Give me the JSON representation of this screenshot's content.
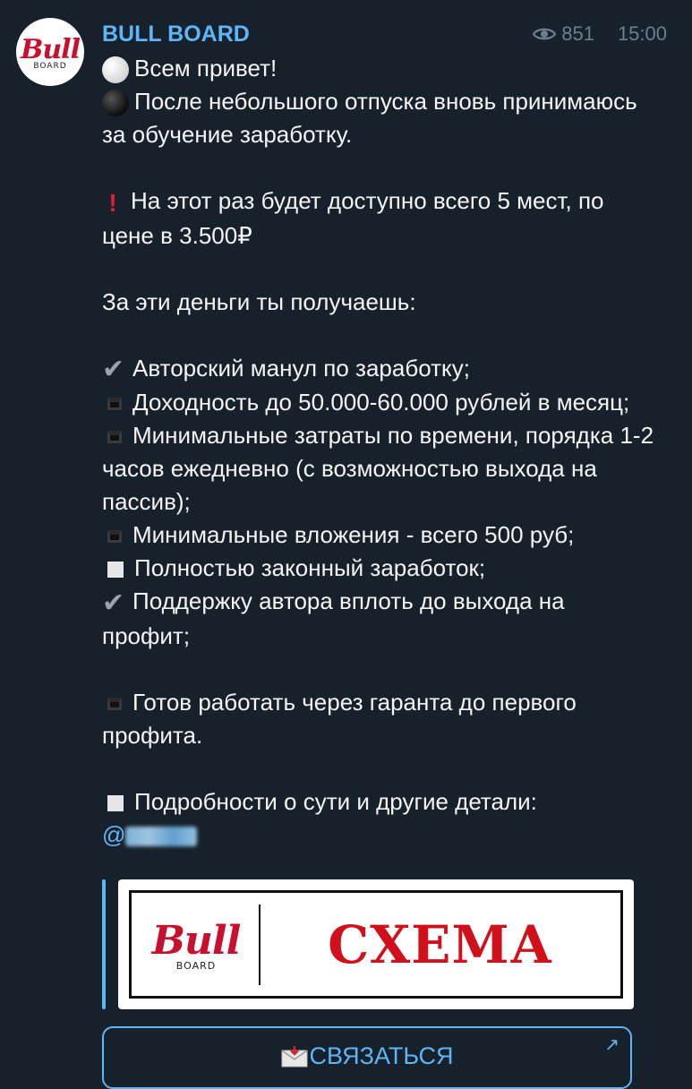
{
  "channel": {
    "name": "BULL BOARD",
    "views": "851",
    "time": "15:00",
    "avatar_logo": "Bull",
    "avatar_sub": "BOARD",
    "accent_color": "#5eb5f7",
    "brand_red": "#c8102e"
  },
  "message": {
    "line_greeting": "Всем привет!",
    "line_intro": "После небольшого отпуска вновь принимаюсь за обучение заработку.",
    "line_places": "На этот раз будет доступно всего 5 мест, по цене в 3.500₽",
    "line_you_get": "За эти деньги ты получаешь:",
    "features": [
      {
        "icon": "check-icon",
        "text": "Авторский манул по заработку;"
      },
      {
        "icon": "black-square-icon",
        "text": "Доходность до 50.000-60.000 рублей в месяц;"
      },
      {
        "icon": "black-square-icon",
        "text": "Минимальные затраты по времени, порядка 1-2 часов ежедневно (с возможностью выхода на пассив);"
      },
      {
        "icon": "black-square-icon",
        "text": "Минимальные вложения - всего 500 руб;"
      },
      {
        "icon": "white-square-icon",
        "text": "Полностью законный заработок;"
      },
      {
        "icon": "check-icon",
        "text": "Поддержку автора вплоть до выхода на профит;"
      }
    ],
    "line_guarantor": "Готов работать через гаранта до первого профита.",
    "line_details": "Подробности о сути и другие детали:",
    "mention_prefix": "@"
  },
  "preview": {
    "logo": "Bull",
    "logo_sub": "BOARD",
    "title": "СХЕМА"
  },
  "button": {
    "label": "СВЯЗАТЬСЯ",
    "arrow": "↗"
  }
}
